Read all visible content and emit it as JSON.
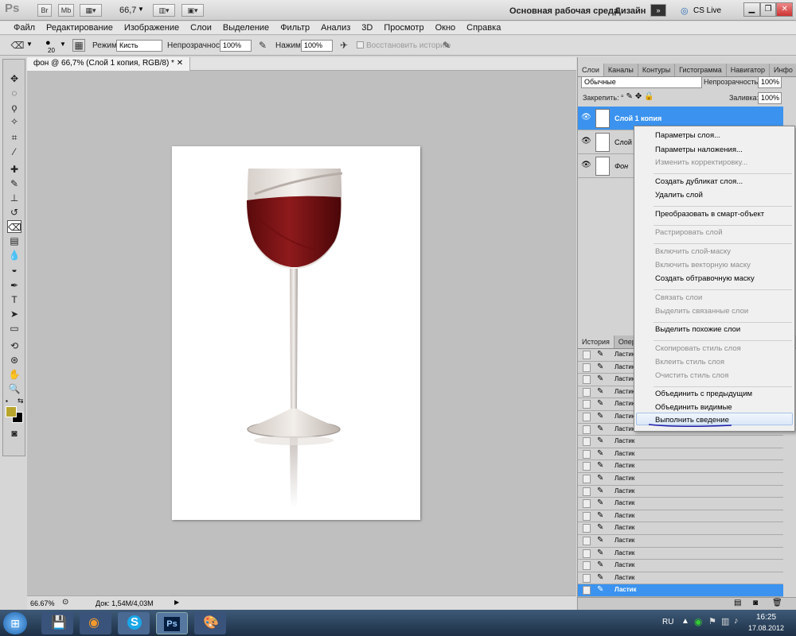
{
  "appbar": {
    "logo": "Ps",
    "buttons": [
      "Br",
      "Mb"
    ],
    "zoom": "66,7",
    "workspace_primary": "Основная рабочая среда",
    "workspace_secondary": "Дизайн",
    "cs_live": "CS Live"
  },
  "menubar": [
    "Файл",
    "Редактирование",
    "Изображение",
    "Слои",
    "Выделение",
    "Фильтр",
    "Анализ",
    "3D",
    "Просмотр",
    "Окно",
    "Справка"
  ],
  "options": {
    "brush_size": "20",
    "mode_label": "Режим:",
    "mode_value": "Кисть",
    "opacity_label": "Непрозрачность:",
    "opacity_value": "100%",
    "pressure_label": "Нажим:",
    "pressure_value": "100%",
    "history_label": "Восстановить историю"
  },
  "document": {
    "tab_title": "фон @ 66,7% (Слой 1 копия, RGB/8) *",
    "status_zoom": "66.67%",
    "status_doc": "Док: 1,54М/4,03М"
  },
  "layers_panel": {
    "tabs": [
      "Слои",
      "Каналы",
      "Контуры",
      "Гистограмма",
      "Навигатор",
      "Инфо"
    ],
    "blend_mode": "Обычные",
    "opacity_label": "Непрозрачность:",
    "opacity_value": "100%",
    "lock_label": "Закрепить:",
    "fill_label": "Заливка:",
    "fill_value": "100%",
    "layers": [
      "Слой 1 копия",
      "Слой 1",
      "Фон"
    ]
  },
  "history_panel": {
    "tabs": [
      "История",
      "Опер"
    ],
    "item_label": "Ластик",
    "item_count": 20
  },
  "context_menu": {
    "items": [
      {
        "label": "Параметры слоя...",
        "disabled": false
      },
      {
        "label": "Параметры наложения...",
        "disabled": false
      },
      {
        "label": "Изменить корректировку...",
        "disabled": true
      },
      {
        "label": "Создать дубликат слоя...",
        "disabled": false
      },
      {
        "label": "Удалить слой",
        "disabled": false
      },
      {
        "label": "Преобразовать в смарт-объект",
        "disabled": false
      },
      {
        "label": "Растрировать слой",
        "disabled": true
      },
      {
        "label": "Включить слой-маску",
        "disabled": true
      },
      {
        "label": "Включить векторную маску",
        "disabled": true
      },
      {
        "label": "Создать обтравочную маску",
        "disabled": false
      },
      {
        "label": "Связать слои",
        "disabled": true
      },
      {
        "label": "Выделить связанные слои",
        "disabled": true
      },
      {
        "label": "Выделить похожие слои",
        "disabled": false
      },
      {
        "label": "Скопировать стиль слоя",
        "disabled": true
      },
      {
        "label": "Вклеить стиль слоя",
        "disabled": true
      },
      {
        "label": "Очистить стиль слоя",
        "disabled": true
      },
      {
        "label": "Объединить с предыдущим",
        "disabled": false
      },
      {
        "label": "Объединить видимые",
        "disabled": false
      },
      {
        "label": "Выполнить сведение",
        "disabled": false
      }
    ]
  },
  "taskbar": {
    "lang": "RU",
    "time": "16:25",
    "date": "17.08.2012"
  },
  "colors": {
    "selection": "#3b93ef",
    "foreground_swatch": "#b8a52c",
    "wine": "#7a0f13"
  }
}
